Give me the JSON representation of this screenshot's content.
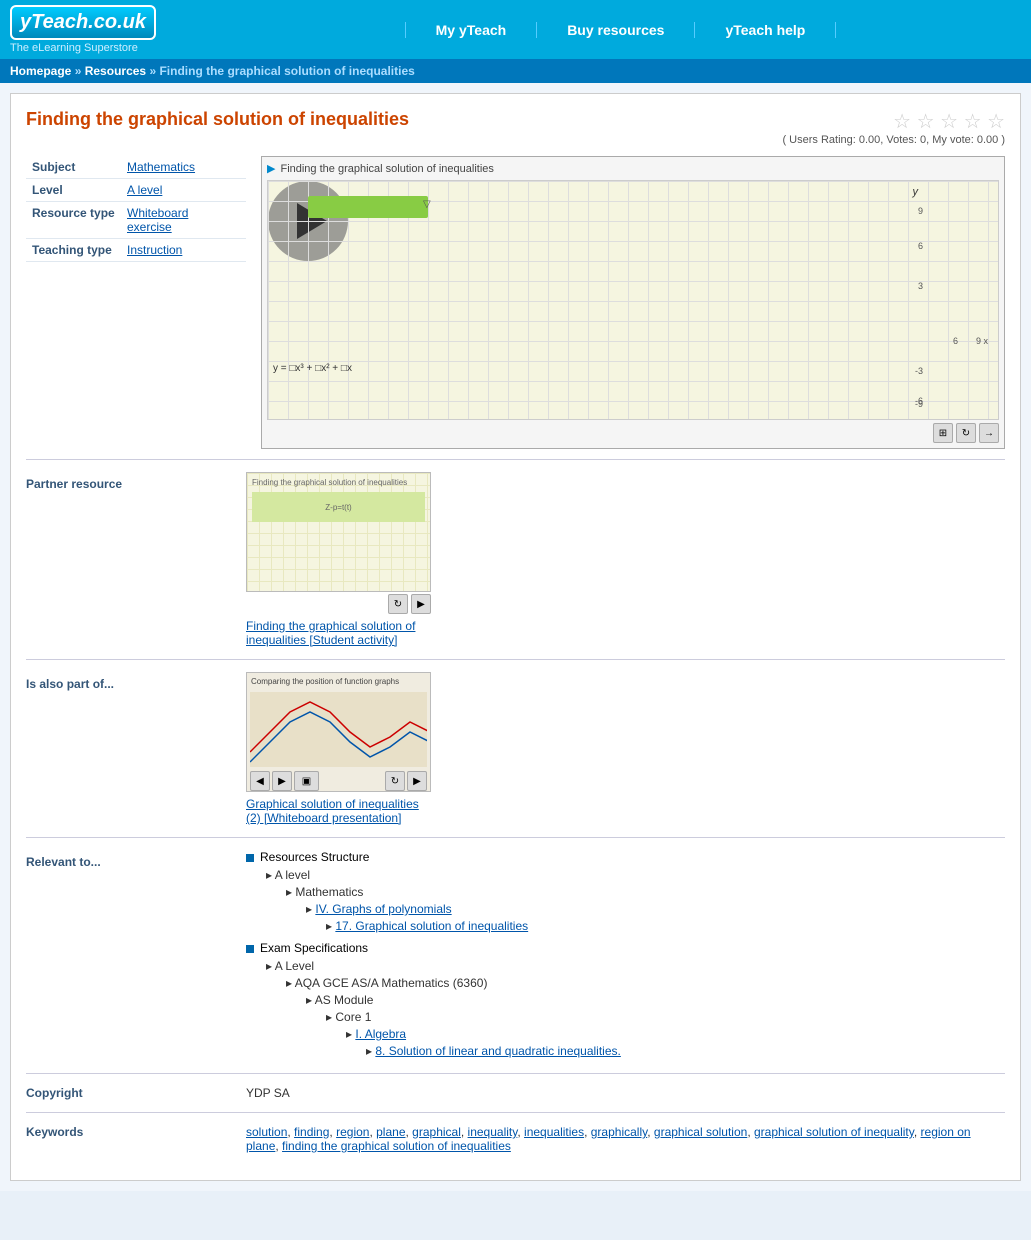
{
  "site": {
    "logo_text": "yTeach.co.uk",
    "logo_sub": "The eLearning Superstore"
  },
  "nav": {
    "items": [
      {
        "label": "My yTeach",
        "id": "my-yteach"
      },
      {
        "label": "Buy resources",
        "id": "buy-resources"
      },
      {
        "label": "yTeach help",
        "id": "yteach-help"
      }
    ]
  },
  "breadcrumb": {
    "items": [
      "Homepage",
      "Resources",
      "Finding the graphical solution of inequalities"
    ],
    "separator": "»"
  },
  "page": {
    "title": "Finding the graphical solution of inequalities",
    "rating": "( Users Rating: 0.00,  Votes: 0,  My vote: 0.00 )",
    "subject_label": "Subject",
    "subject_value": "Mathematics",
    "level_label": "Level",
    "level_value": "A level",
    "resource_type_label": "Resource type",
    "resource_type_value": "Whiteboard exercise",
    "teaching_type_label": "Teaching type",
    "teaching_type_value": "Instruction",
    "preview_title": "Finding the graphical solution of inequalities"
  },
  "partner": {
    "label": "Partner resource",
    "thumb_alt": "Finding the graphical solution of inequalities thumbnail",
    "link_text": "Finding the graphical solution of inequalities [Student activity]"
  },
  "part_of": {
    "label": "Is also part of...",
    "thumb_alt": "Graphical solution of inequalities thumbnail",
    "link_text": "Graphical solution of inequalities (2) [Whiteboard presentation]"
  },
  "relevant": {
    "label": "Relevant to...",
    "sections": [
      {
        "type": "header",
        "text": "Resources Structure"
      },
      {
        "type": "indent1",
        "text": "A level"
      },
      {
        "type": "indent2",
        "text": "Mathematics"
      },
      {
        "type": "indent3",
        "text": "IV. Graphs of polynomials",
        "link": true
      },
      {
        "type": "indent4",
        "text": "17. Graphical solution of inequalities",
        "link": true
      },
      {
        "type": "header",
        "text": "Exam Specifications"
      },
      {
        "type": "indent1",
        "text": "A Level"
      },
      {
        "type": "indent2",
        "text": "AQA GCE AS/A Mathematics (6360)"
      },
      {
        "type": "indent3",
        "text": "AS Module"
      },
      {
        "type": "indent4",
        "text": "Core 1"
      },
      {
        "type": "indent5",
        "text": "I. Algebra",
        "link": true
      },
      {
        "type": "indent6",
        "text": "8. Solution of linear and quadratic inequalities.",
        "link": true
      }
    ]
  },
  "copyright": {
    "label": "Copyright",
    "value": "YDP SA"
  },
  "keywords": {
    "label": "Keywords",
    "items": [
      "solution",
      "finding",
      "region",
      "plane",
      "graphical",
      "inequality",
      "inequalities",
      "graphically",
      "graphical solution",
      "graphical solution of inequality",
      "region on plane",
      "finding the graphical solution of inequalities"
    ]
  }
}
